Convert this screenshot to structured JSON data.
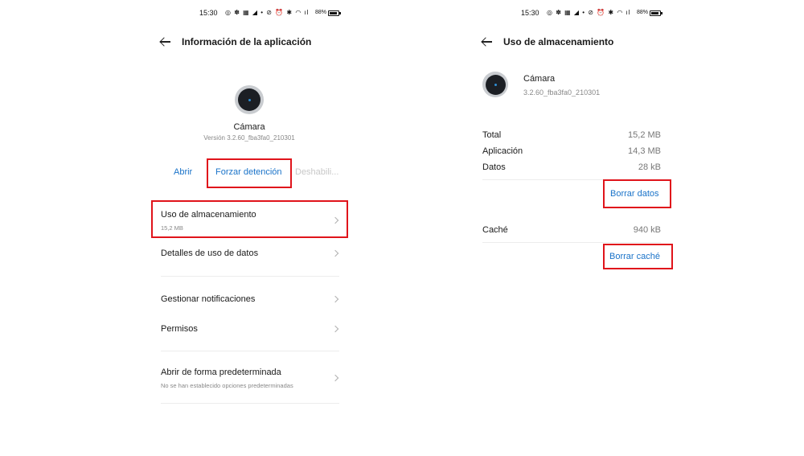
{
  "status_bar": {
    "time": "15:30",
    "icons_text": "◎ ✽ ▦ ◢  •  ⊘ ⏰ ✱ ◠ ıl",
    "battery_pct": "88%"
  },
  "left": {
    "header_title": "Información de la aplicación",
    "app_icon": "camera-app-icon",
    "app_name": "Cámara",
    "app_version": "Versión 3.2.60_fba3fa0_210301",
    "actions": {
      "open": "Abrir",
      "force_stop": "Forzar detención",
      "disable": "Deshabili..."
    },
    "rows": {
      "storage": {
        "title": "Uso de almacenamiento",
        "sub": "15,2 MB"
      },
      "data_usage": {
        "title": "Detalles de uso de datos"
      },
      "notifications": {
        "title": "Gestionar notificaciones"
      },
      "permissions": {
        "title": "Permisos"
      },
      "default_open": {
        "title": "Abrir de forma predeterminada",
        "sub": "No se han establecido opciones predeterminadas"
      }
    }
  },
  "right": {
    "header_title": "Uso de almacenamiento",
    "app_name": "Cámara",
    "app_version": "3.2.60_fba3fa0_210301",
    "total": {
      "label": "Total",
      "value": "15,2 MB"
    },
    "app": {
      "label": "Aplicación",
      "value": "14,3 MB"
    },
    "data": {
      "label": "Datos",
      "value": "28 kB"
    },
    "clear_data": "Borrar datos",
    "cache": {
      "label": "Caché",
      "value": "940 kB"
    },
    "clear_cache": "Borrar caché"
  },
  "colors": {
    "accent": "#1a73c9",
    "highlight": "#e0141b",
    "muted": "#888888"
  }
}
